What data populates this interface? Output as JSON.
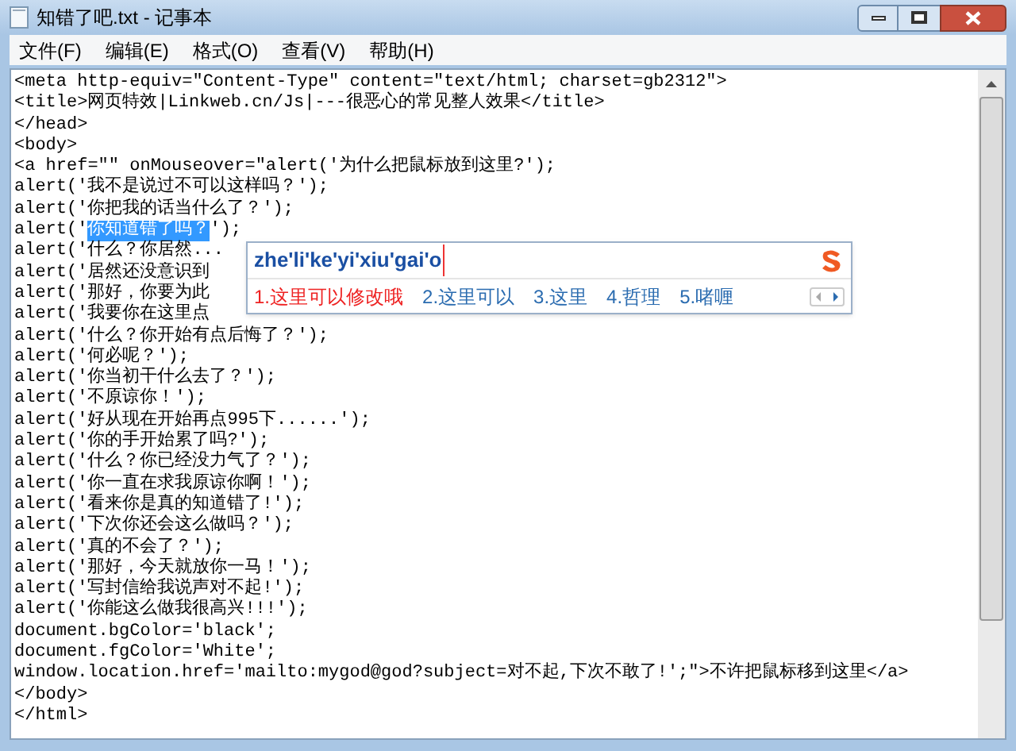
{
  "window": {
    "title": "知错了吧.txt - 记事本"
  },
  "menu": [
    "文件(F)",
    "编辑(E)",
    "格式(O)",
    "查看(V)",
    "帮助(H)"
  ],
  "lines": [
    [
      {
        "text": "<meta http-equiv=\"Content-Type\" content=\"text/html; charset=gb2312\">",
        "selected": false
      }
    ],
    [
      {
        "text": "<title>网页特效|Linkweb.cn/Js|---很恶心的常见整人效果</title>",
        "selected": false
      }
    ],
    [
      {
        "text": "</head>",
        "selected": false
      }
    ],
    [
      {
        "text": "<body>",
        "selected": false
      }
    ],
    [
      {
        "text": "<a href=\"\" onMouseover=\"alert('为什么把鼠标放到这里?');",
        "selected": false
      }
    ],
    [
      {
        "text": "alert('我不是说过不可以这样吗？');",
        "selected": false
      }
    ],
    [
      {
        "text": "alert('你把我的话当什么了？');",
        "selected": false
      }
    ],
    [
      {
        "text": "alert('",
        "selected": false
      },
      {
        "text": "你知道错了吗？",
        "selected": true
      },
      {
        "text": "');",
        "selected": false
      }
    ],
    [
      {
        "text": "alert('什么？你居然...",
        "selected": false
      }
    ],
    [
      {
        "text": "alert('居然还没意识到",
        "selected": false
      }
    ],
    [
      {
        "text": "alert('那好，你要为此",
        "selected": false
      }
    ],
    [
      {
        "text": "alert('我要你在这里点",
        "selected": false
      }
    ],
    [
      {
        "text": "alert('什么？你开始有点后悔了？');",
        "selected": false
      }
    ],
    [
      {
        "text": "alert('何必呢？');",
        "selected": false
      }
    ],
    [
      {
        "text": "alert('你当初干什么去了？');",
        "selected": false
      }
    ],
    [
      {
        "text": "alert('不原谅你！');",
        "selected": false
      }
    ],
    [
      {
        "text": "alert('好从现在开始再点995下......');",
        "selected": false
      }
    ],
    [
      {
        "text": "alert('你的手开始累了吗?');",
        "selected": false
      }
    ],
    [
      {
        "text": "alert('什么？你已经没力气了？');",
        "selected": false
      }
    ],
    [
      {
        "text": "alert('你一直在求我原谅你啊！');",
        "selected": false
      }
    ],
    [
      {
        "text": "alert('看来你是真的知道错了!');",
        "selected": false
      }
    ],
    [
      {
        "text": "alert('下次你还会这么做吗？');",
        "selected": false
      }
    ],
    [
      {
        "text": "alert('真的不会了？');",
        "selected": false
      }
    ],
    [
      {
        "text": "alert('那好，今天就放你一马！');",
        "selected": false
      }
    ],
    [
      {
        "text": "alert('写封信给我说声对不起!');",
        "selected": false
      }
    ],
    [
      {
        "text": "alert('你能这么做我很高兴!!!');",
        "selected": false
      }
    ],
    [
      {
        "text": "document.bgColor='black';",
        "selected": false
      }
    ],
    [
      {
        "text": "document.fgColor='White';",
        "selected": false
      }
    ],
    [
      {
        "text": "window.location.href='mailto:mygod@god?subject=对不起,下次不敢了!';\">不许把鼠标移到这里</a>",
        "selected": false
      }
    ],
    [
      {
        "text": "</body>",
        "selected": false
      }
    ],
    [
      {
        "text": "</html>",
        "selected": false
      }
    ]
  ],
  "ime": {
    "composition": "zhe'li'ke'yi'xiu'gai'o",
    "candidates": [
      {
        "text": "1.这里可以修改哦",
        "selected": true
      },
      {
        "text": "2.这里可以",
        "selected": false
      },
      {
        "text": "3.这里",
        "selected": false
      },
      {
        "text": "4.哲理",
        "selected": false
      },
      {
        "text": "5.啫喱",
        "selected": false
      }
    ]
  }
}
